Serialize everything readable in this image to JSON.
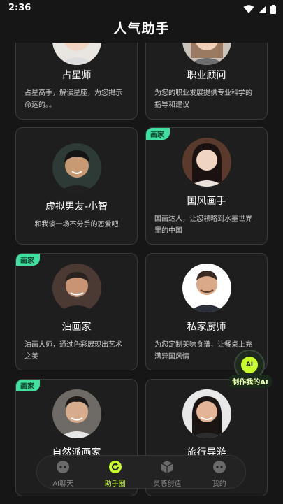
{
  "status": {
    "time": "2:36"
  },
  "header": {
    "title": "人气助手"
  },
  "cards": [
    {
      "name": "占星师",
      "desc": "占星高手，解读星座，为您揭示命运的。。",
      "badge": ""
    },
    {
      "name": "职业顾问",
      "desc": "为您的职业发展提供专业科学的指导和建议",
      "badge": ""
    },
    {
      "name": "虚拟男友-小智",
      "desc": "和我谈一场不分手的恋爱吧",
      "badge": ""
    },
    {
      "name": "国风画手",
      "desc": "国画达人，让您领略到水墨世界里的中国",
      "badge": "画家"
    },
    {
      "name": "油画家",
      "desc": "油画大师，通过色彩展现出艺术之美",
      "badge": "画家"
    },
    {
      "name": "私家厨师",
      "desc": "为您定制美味食谱，让餐桌上充满异国风情",
      "badge": ""
    },
    {
      "name": "自然派画家",
      "desc": "",
      "badge": "画家"
    },
    {
      "name": "旅行导游",
      "desc": "",
      "badge": ""
    }
  ],
  "float_button": {
    "icon_text": "AI",
    "label": "制作我的AI"
  },
  "tabs": [
    {
      "label": "AI聊天",
      "icon": "chat-bot-icon",
      "active": false
    },
    {
      "label": "助手圈",
      "icon": "refresh-circle-icon",
      "active": true
    },
    {
      "label": "灵感创造",
      "icon": "cube-icon",
      "active": false
    },
    {
      "label": "我的",
      "icon": "profile-bot-icon",
      "active": false
    }
  ],
  "colors": {
    "accent": "#c8ff2a",
    "badge": "#3fe0a0",
    "background": "#161616",
    "card": "#1e1e1e"
  }
}
